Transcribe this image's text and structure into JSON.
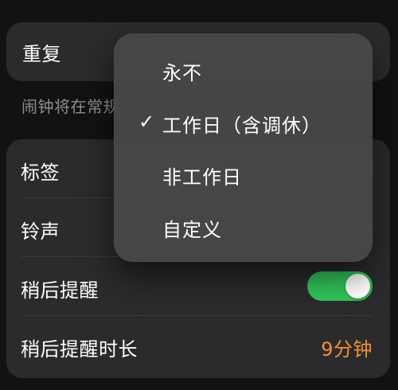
{
  "repeat_section": {
    "label": "重复",
    "hint": "闹钟将在常规"
  },
  "settings": {
    "rows": [
      {
        "label": "标签"
      },
      {
        "label": "铃声"
      },
      {
        "label": "稍后提醒",
        "enabled": true
      },
      {
        "label": "稍后提醒时长",
        "value": "9分钟"
      }
    ],
    "accent_color": "#F5912E",
    "toggle_color": "#32C55A"
  },
  "dropdown": {
    "items": [
      {
        "label": "永不",
        "selected": false
      },
      {
        "label": "工作日（含调休）",
        "selected": true
      },
      {
        "label": "非工作日",
        "selected": false
      },
      {
        "label": "自定义",
        "selected": false
      }
    ],
    "check_glyph": "✓"
  }
}
